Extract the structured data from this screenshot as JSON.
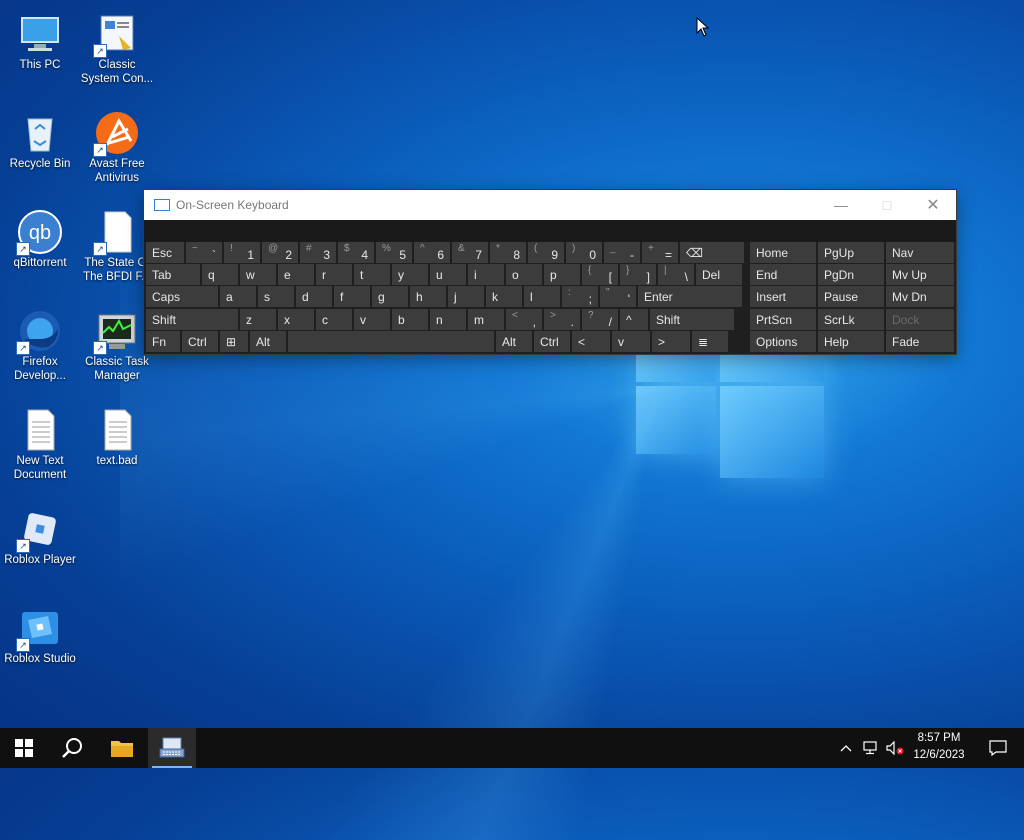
{
  "desktop": {
    "icons": [
      {
        "label": "This PC",
        "icon": "this-pc-icon"
      },
      {
        "label": "Classic System Con...",
        "icon": "control-panel-icon"
      },
      {
        "label": "Recycle Bin",
        "icon": "recycle-bin-icon"
      },
      {
        "label": "Avast Free Antivirus",
        "icon": "avast-icon"
      },
      {
        "label": "qBittorrent",
        "icon": "qbittorrent-icon"
      },
      {
        "label": "The State Of The BFDI F...",
        "icon": "document-icon"
      },
      {
        "label": "Firefox Develop...",
        "icon": "firefox-icon"
      },
      {
        "label": "Classic Task Manager",
        "icon": "task-manager-icon"
      },
      {
        "label": "New Text Document",
        "icon": "text-file-icon"
      },
      {
        "label": "text.bad",
        "icon": "text-file-icon"
      },
      {
        "label": "Roblox Player",
        "icon": "roblox-player-icon"
      },
      {
        "label": "Roblox Studio",
        "icon": "roblox-studio-icon"
      }
    ]
  },
  "osk": {
    "title": "On-Screen Keyboard",
    "row1": [
      {
        "main": "Esc"
      },
      {
        "top": "~",
        "bottom": "`"
      },
      {
        "top": "!",
        "bottom": "1"
      },
      {
        "top": "@",
        "bottom": "2"
      },
      {
        "top": "#",
        "bottom": "3"
      },
      {
        "top": "$",
        "bottom": "4"
      },
      {
        "top": "%",
        "bottom": "5"
      },
      {
        "top": "^",
        "bottom": "6"
      },
      {
        "top": "&",
        "bottom": "7"
      },
      {
        "top": "*",
        "bottom": "8"
      },
      {
        "top": "(",
        "bottom": "9"
      },
      {
        "top": ")",
        "bottom": "0"
      },
      {
        "top": "_",
        "bottom": "-"
      },
      {
        "top": "+",
        "bottom": "="
      },
      {
        "main": "⌫"
      }
    ],
    "row2": [
      {
        "main": "Tab"
      },
      {
        "main": "q"
      },
      {
        "main": "w"
      },
      {
        "main": "e"
      },
      {
        "main": "r"
      },
      {
        "main": "t"
      },
      {
        "main": "y"
      },
      {
        "main": "u"
      },
      {
        "main": "i"
      },
      {
        "main": "o"
      },
      {
        "main": "p"
      },
      {
        "top": "{",
        "bottom": "["
      },
      {
        "top": "}",
        "bottom": "]"
      },
      {
        "top": "|",
        "bottom": "\\"
      },
      {
        "main": "Del"
      }
    ],
    "row3": [
      {
        "main": "Caps"
      },
      {
        "main": "a"
      },
      {
        "main": "s"
      },
      {
        "main": "d"
      },
      {
        "main": "f"
      },
      {
        "main": "g"
      },
      {
        "main": "h"
      },
      {
        "main": "j"
      },
      {
        "main": "k"
      },
      {
        "main": "l"
      },
      {
        "top": ":",
        "bottom": ";"
      },
      {
        "top": "\"",
        "bottom": "'"
      },
      {
        "main": "Enter"
      }
    ],
    "row4": [
      {
        "main": "Shift"
      },
      {
        "main": "z"
      },
      {
        "main": "x"
      },
      {
        "main": "c"
      },
      {
        "main": "v"
      },
      {
        "main": "b"
      },
      {
        "main": "n"
      },
      {
        "main": "m"
      },
      {
        "top": "<",
        "bottom": ","
      },
      {
        "top": ">",
        "bottom": "."
      },
      {
        "top": "?",
        "bottom": "/"
      },
      {
        "main": "^"
      },
      {
        "main": "Shift"
      }
    ],
    "row5": [
      {
        "main": "Fn"
      },
      {
        "main": "Ctrl"
      },
      {
        "main": "⊞"
      },
      {
        "main": "Alt"
      },
      {
        "main": ""
      },
      {
        "main": "Alt"
      },
      {
        "main": "Ctrl"
      },
      {
        "main": "<"
      },
      {
        "main": "v"
      },
      {
        "main": ">"
      },
      {
        "main": "≣"
      }
    ],
    "nav_keys": [
      [
        "Home",
        "PgUp",
        "Nav"
      ],
      [
        "End",
        "PgDn",
        "Mv Up"
      ],
      [
        "Insert",
        "Pause",
        "Mv Dn"
      ],
      [
        "PrtScn",
        "ScrLk",
        "Dock"
      ],
      [
        "Options",
        "Help",
        "Fade"
      ]
    ]
  },
  "taskbar": {
    "time": "8:57 PM",
    "date": "12/6/2023",
    "items": [
      "start-icon",
      "search-icon",
      "file-explorer-icon",
      "on-screen-keyboard-icon"
    ]
  }
}
